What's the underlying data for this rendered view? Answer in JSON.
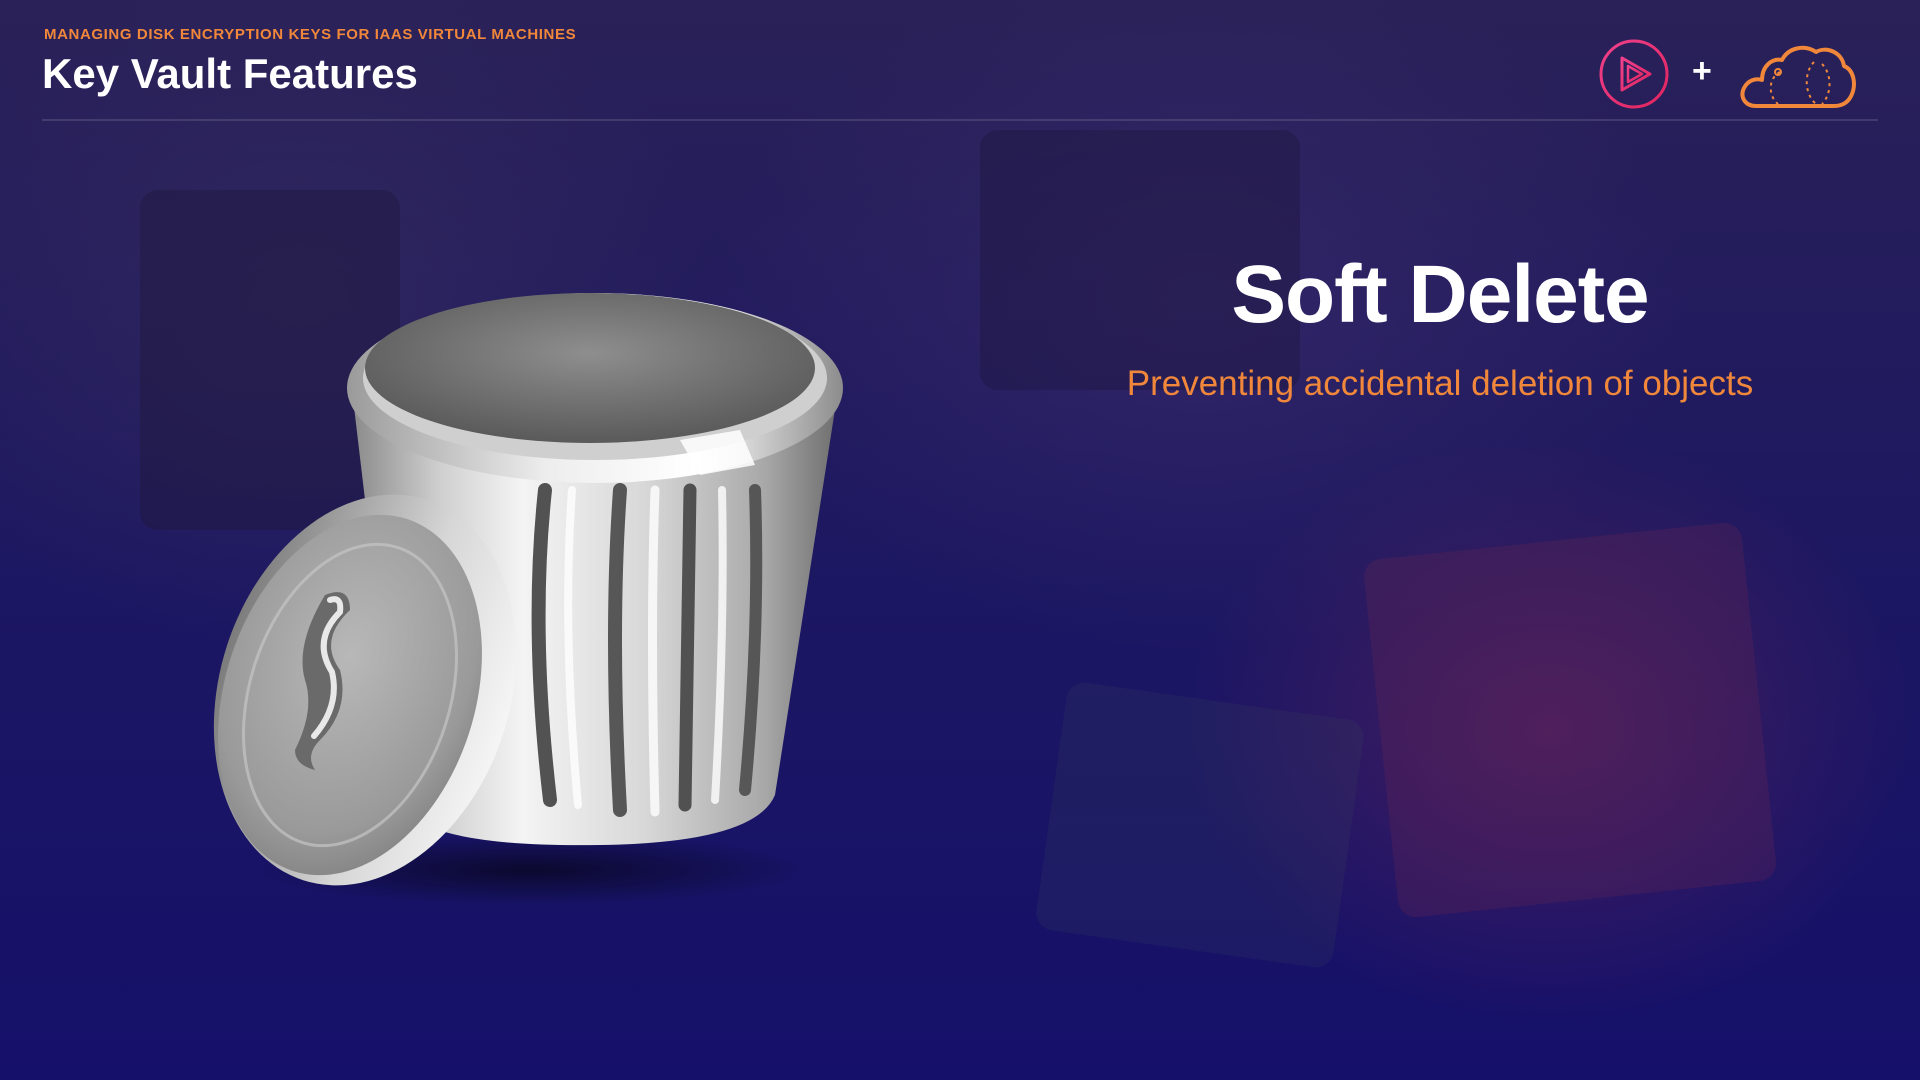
{
  "header": {
    "overline": "MANAGING DISK ENCRYPTION KEYS FOR IAAS VIRTUAL MACHINES",
    "title": "Key Vault Features"
  },
  "logos": {
    "left_icon": "play-circle-icon",
    "separator": "+",
    "right_icon": "cloud-icon",
    "colors": {
      "play": "#e0245e",
      "cloud": "#f0873a"
    }
  },
  "hero": {
    "title": "Soft Delete",
    "subtitle": "Preventing accidental deletion of objects",
    "illustration": "trash-can-icon"
  },
  "colors": {
    "accent": "#f0873a",
    "background": "#1c1762",
    "text": "#ffffff"
  }
}
